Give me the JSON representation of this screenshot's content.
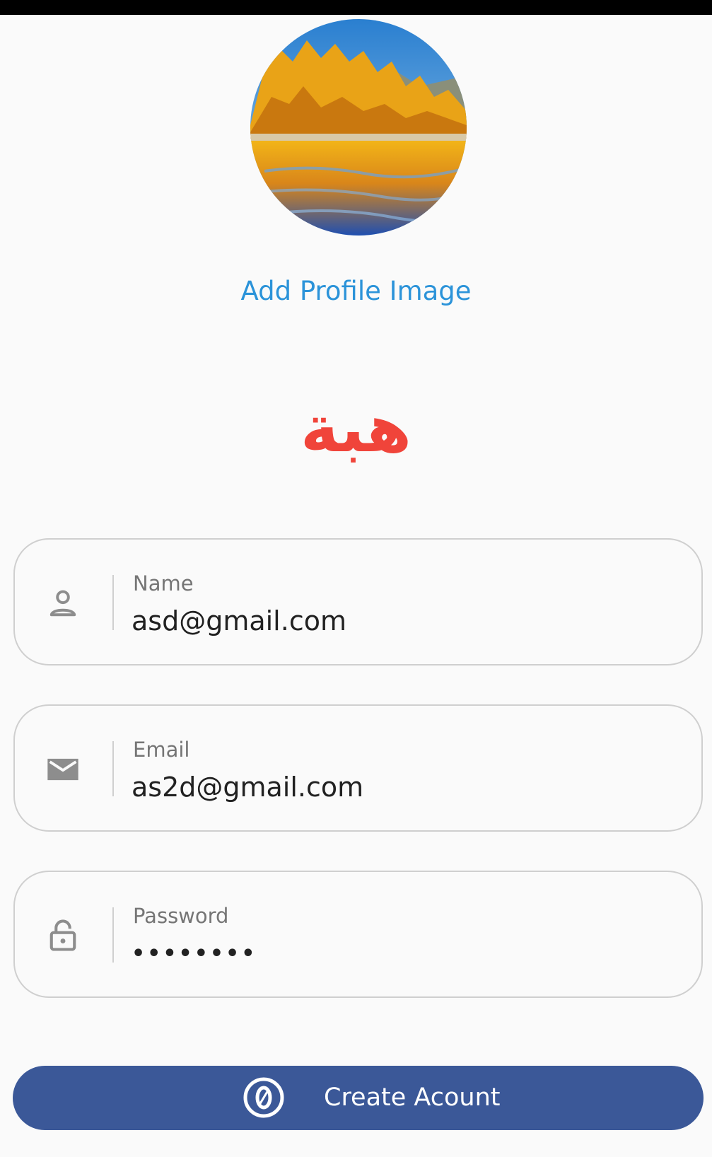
{
  "profile": {
    "image_description_icon": "landscape-photo",
    "add_image_label": "Add Profile Image"
  },
  "brand": {
    "title": "هبة",
    "color": "#f0443a"
  },
  "form": {
    "name": {
      "label": "Name",
      "value": "asd@gmail.com",
      "icon": "person-icon"
    },
    "email": {
      "label": "Email",
      "value": "as2d@gmail.com",
      "icon": "mail-icon"
    },
    "password": {
      "label": "Password",
      "value": "••••••••",
      "icon": "lock-icon"
    }
  },
  "submit": {
    "label": "Create Acount",
    "icon": "zero-circle-icon",
    "color": "#3b5898"
  },
  "colors": {
    "link": "#2b93d9",
    "field_border": "#cfcfcf",
    "background": "#fafafa"
  }
}
